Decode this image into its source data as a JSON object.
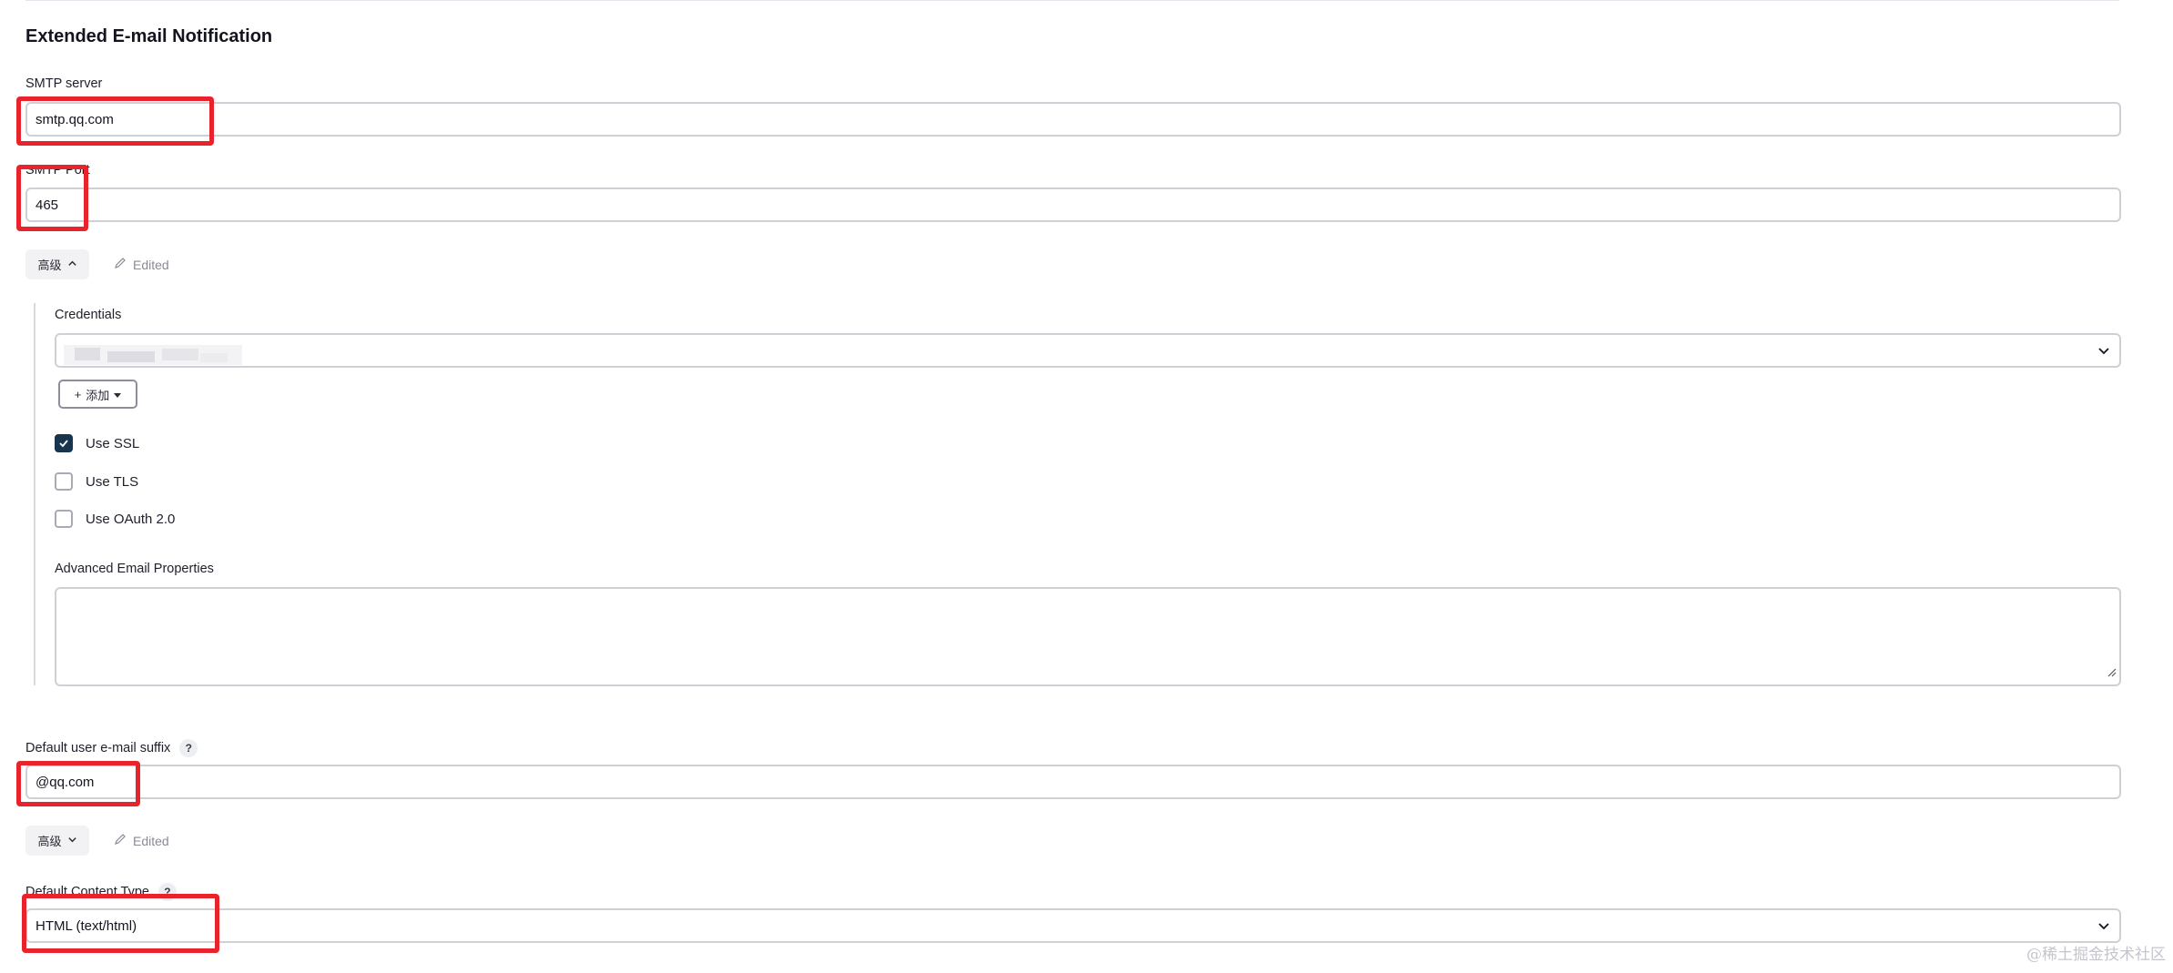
{
  "section": {
    "title": "Extended E-mail Notification"
  },
  "smtp_server": {
    "label": "SMTP server",
    "value": "smtp.qq.com"
  },
  "smtp_port": {
    "label": "SMTP Port",
    "value": "465"
  },
  "advanced_1": {
    "button_label": "高级",
    "edited_label": "Edited",
    "expanded": true
  },
  "credentials": {
    "label": "Credentials",
    "add_label": "添加"
  },
  "options": {
    "use_ssl": {
      "label": "Use SSL",
      "checked": true
    },
    "use_tls": {
      "label": "Use TLS",
      "checked": false
    },
    "use_oauth": {
      "label": "Use OAuth 2.0",
      "checked": false
    }
  },
  "advanced_email_properties": {
    "label": "Advanced Email Properties",
    "value": ""
  },
  "default_suffix": {
    "label": "Default user e-mail suffix",
    "help": "?",
    "value": "@qq.com"
  },
  "advanced_2": {
    "button_label": "高级",
    "edited_label": "Edited",
    "expanded": false
  },
  "default_content_type": {
    "label": "Default Content Type",
    "help": "?",
    "value": "HTML (text/html)"
  },
  "watermark": "@稀土掘金技术社区",
  "colors": {
    "highlight": "#e8232b",
    "checkbox_checked": "#18354f"
  }
}
